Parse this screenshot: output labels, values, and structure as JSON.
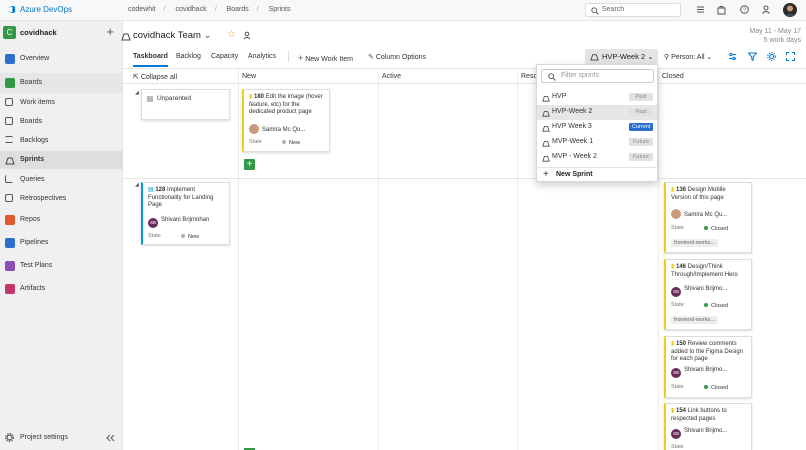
{
  "app": {
    "brand": "Azure DevOps"
  },
  "breadcrumbs": [
    "codewhit",
    "covidhack",
    "Boards",
    "Sprints"
  ],
  "search": {
    "placeholder": "Search"
  },
  "sidebar": {
    "project": {
      "initial": "C",
      "name": "covidhack"
    },
    "items": [
      {
        "label": "Overview"
      },
      {
        "label": "Boards"
      },
      {
        "label": "Work items"
      },
      {
        "label": "Boards"
      },
      {
        "label": "Backlogs"
      },
      {
        "label": "Sprints"
      },
      {
        "label": "Queries"
      },
      {
        "label": "Retrospectives"
      },
      {
        "label": "Repos"
      },
      {
        "label": "Pipelines"
      },
      {
        "label": "Test Plans"
      },
      {
        "label": "Artifacts"
      }
    ],
    "settings": "Project settings"
  },
  "header": {
    "team": "covidhack Team",
    "date_range": "May 11 - May 17",
    "work_days": "5 work days",
    "tabs": [
      "Taskboard",
      "Backlog",
      "Capacity",
      "Analytics"
    ],
    "new_work_item": "New Work Item",
    "column_options": "Column Options",
    "sprint_selected": "HVP-Week 2",
    "person_filter": "Person: All"
  },
  "board": {
    "collapse_all": "Collapse all",
    "columns": [
      "New",
      "Active",
      "Resc",
      "Closed"
    ],
    "unparented": "Unparented",
    "state_label": "State",
    "cards": [
      {
        "id": "180",
        "title": "Edit the image (hover feature, etc) for the dedicated product page",
        "assignee": "Samira Mc Qu...",
        "initials": "",
        "state": "New"
      },
      {
        "id": "128",
        "title": "Implement Functionality for  Landing Page",
        "assignee": "Shivani Brijmohan",
        "initials": "SB",
        "state": "New"
      },
      {
        "id": "136",
        "title": "Design Mobile Version of this page",
        "assignee": "Samira Mc Qu...",
        "initials": "",
        "state": "Closed",
        "tag": "frontend-works..."
      },
      {
        "id": "146",
        "title": "Design/Think Through/Implement Hero",
        "assignee": "Shivani Brijmo...",
        "initials": "SB",
        "state": "Closed",
        "tag": "frontend-works..."
      },
      {
        "id": "150",
        "title": "Review comments added to the  Figma  Design for each page",
        "assignee": "Shivani Brijmo...",
        "initials": "SB",
        "state": "Closed"
      },
      {
        "id": "154",
        "title": "Link buttons to respected pages",
        "assignee": "Shivani Brijmo...",
        "initials": "SB",
        "state": ""
      }
    ]
  },
  "dropdown": {
    "filter_placeholder": "Filter sprints",
    "items": [
      {
        "label": "HVP",
        "status": "Past"
      },
      {
        "label": "HVP-Week 2",
        "status": "Past"
      },
      {
        "label": "HVP Week 3",
        "status": "Current"
      },
      {
        "label": "MVP-Week 1",
        "status": "Future"
      },
      {
        "label": "MVP - Week 2",
        "status": "Future"
      }
    ],
    "new_sprint": "New Sprint"
  },
  "colors": {
    "accent": "#0078d4",
    "green": "#339947",
    "closed": "#339947",
    "new": "#b2b2b2"
  }
}
